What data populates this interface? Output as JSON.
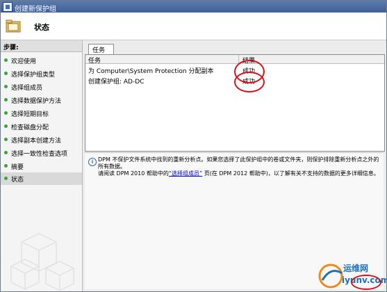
{
  "window": {
    "title": "创建新保护组"
  },
  "header": {
    "title": "状态"
  },
  "sidebar": {
    "title": "步骤:",
    "items": [
      {
        "label": "欢迎使用"
      },
      {
        "label": "选择保护组类型"
      },
      {
        "label": "选择组成员"
      },
      {
        "label": "选择数据保护方法"
      },
      {
        "label": "选择短期目标"
      },
      {
        "label": "检查磁盘分配"
      },
      {
        "label": "选择副本创建方法"
      },
      {
        "label": "选择一致性检查选项"
      },
      {
        "label": "摘要"
      },
      {
        "label": "状态"
      }
    ]
  },
  "tabs": {
    "task": "任务"
  },
  "grid": {
    "columns": [
      "任务",
      "结果"
    ],
    "rows": [
      {
        "task": "为 Computer\\System Protection 分配副本",
        "result": "成功"
      },
      {
        "task": "创建保护组: AD-DC",
        "result": "成功"
      }
    ]
  },
  "info": {
    "line1": "DPM 不保护文件系统中找到的重新分析点。如果您选择了此保护组中的卷或文件夹，则保护排除重新分析点之外的所有数据。",
    "line2_pre": "请阅读 DPM 2010 帮助中的",
    "link": "“选择组成员”",
    "line2_post": " 页(在 DPM 2012 帮助中)，以了解有关不支持的数据的更多详细信息。"
  },
  "watermark": {
    "top": "运维网",
    "bottom": "iyunv.com"
  },
  "colors": {
    "accent_red": "#d3121b",
    "title_blue": "#3f5f96",
    "step_green": "#3aa33a"
  }
}
